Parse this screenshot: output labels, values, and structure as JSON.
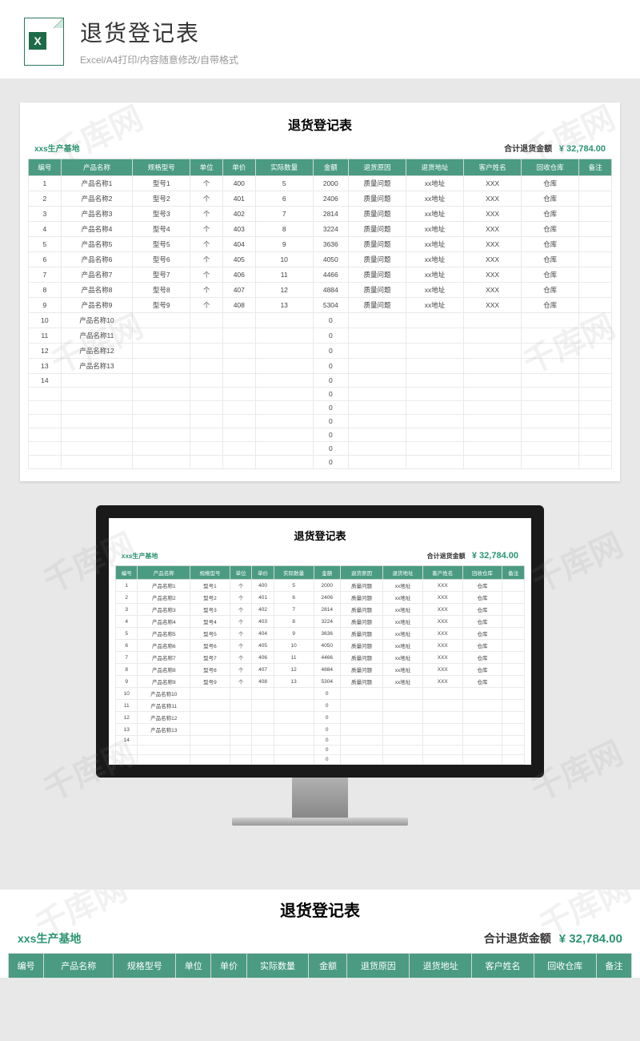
{
  "header": {
    "title": "退货登记表",
    "subtitle": "Excel/A4打印/内容随意修改/自带格式",
    "icon_letter": "X"
  },
  "sheet": {
    "title": "退货登记表",
    "company": "xxs生产基地",
    "total_label": "合计退货金额",
    "total_amount": "¥ 32,784.00"
  },
  "columns": [
    "编号",
    "产品名称",
    "规格型号",
    "单位",
    "单价",
    "实际数量",
    "金额",
    "退货原因",
    "退货地址",
    "客户姓名",
    "回收仓库",
    "备注"
  ],
  "rows": [
    {
      "no": "1",
      "name": "产品名称1",
      "spec": "型号1",
      "unit": "个",
      "price": "400",
      "qty": "5",
      "amount": "2000",
      "reason": "质量问题",
      "addr": "xx地址",
      "cust": "XXX",
      "wh": "仓库",
      "remark": ""
    },
    {
      "no": "2",
      "name": "产品名称2",
      "spec": "型号2",
      "unit": "个",
      "price": "401",
      "qty": "6",
      "amount": "2406",
      "reason": "质量问题",
      "addr": "xx地址",
      "cust": "XXX",
      "wh": "仓库",
      "remark": ""
    },
    {
      "no": "3",
      "name": "产品名称3",
      "spec": "型号3",
      "unit": "个",
      "price": "402",
      "qty": "7",
      "amount": "2814",
      "reason": "质量问题",
      "addr": "xx地址",
      "cust": "XXX",
      "wh": "仓库",
      "remark": ""
    },
    {
      "no": "4",
      "name": "产品名称4",
      "spec": "型号4",
      "unit": "个",
      "price": "403",
      "qty": "8",
      "amount": "3224",
      "reason": "质量问题",
      "addr": "xx地址",
      "cust": "XXX",
      "wh": "仓库",
      "remark": ""
    },
    {
      "no": "5",
      "name": "产品名称5",
      "spec": "型号5",
      "unit": "个",
      "price": "404",
      "qty": "9",
      "amount": "3636",
      "reason": "质量问题",
      "addr": "xx地址",
      "cust": "XXX",
      "wh": "仓库",
      "remark": ""
    },
    {
      "no": "6",
      "name": "产品名称6",
      "spec": "型号6",
      "unit": "个",
      "price": "405",
      "qty": "10",
      "amount": "4050",
      "reason": "质量问题",
      "addr": "xx地址",
      "cust": "XXX",
      "wh": "仓库",
      "remark": ""
    },
    {
      "no": "7",
      "name": "产品名称7",
      "spec": "型号7",
      "unit": "个",
      "price": "406",
      "qty": "11",
      "amount": "4466",
      "reason": "质量问题",
      "addr": "xx地址",
      "cust": "XXX",
      "wh": "仓库",
      "remark": ""
    },
    {
      "no": "8",
      "name": "产品名称8",
      "spec": "型号8",
      "unit": "个",
      "price": "407",
      "qty": "12",
      "amount": "4884",
      "reason": "质量问题",
      "addr": "xx地址",
      "cust": "XXX",
      "wh": "仓库",
      "remark": ""
    },
    {
      "no": "9",
      "name": "产品名称9",
      "spec": "型号9",
      "unit": "个",
      "price": "408",
      "qty": "13",
      "amount": "5304",
      "reason": "质量问题",
      "addr": "xx地址",
      "cust": "XXX",
      "wh": "仓库",
      "remark": ""
    },
    {
      "no": "10",
      "name": "产品名称10",
      "spec": "",
      "unit": "",
      "price": "",
      "qty": "",
      "amount": "0",
      "reason": "",
      "addr": "",
      "cust": "",
      "wh": "",
      "remark": ""
    },
    {
      "no": "11",
      "name": "产品名称11",
      "spec": "",
      "unit": "",
      "price": "",
      "qty": "",
      "amount": "0",
      "reason": "",
      "addr": "",
      "cust": "",
      "wh": "",
      "remark": ""
    },
    {
      "no": "12",
      "name": "产品名称12",
      "spec": "",
      "unit": "",
      "price": "",
      "qty": "",
      "amount": "0",
      "reason": "",
      "addr": "",
      "cust": "",
      "wh": "",
      "remark": ""
    },
    {
      "no": "13",
      "name": "产品名称13",
      "spec": "",
      "unit": "",
      "price": "",
      "qty": "",
      "amount": "0",
      "reason": "",
      "addr": "",
      "cust": "",
      "wh": "",
      "remark": ""
    },
    {
      "no": "14",
      "name": "",
      "spec": "",
      "unit": "",
      "price": "",
      "qty": "",
      "amount": "0",
      "reason": "",
      "addr": "",
      "cust": "",
      "wh": "",
      "remark": ""
    },
    {
      "no": "",
      "name": "",
      "spec": "",
      "unit": "",
      "price": "",
      "qty": "",
      "amount": "0",
      "reason": "",
      "addr": "",
      "cust": "",
      "wh": "",
      "remark": ""
    },
    {
      "no": "",
      "name": "",
      "spec": "",
      "unit": "",
      "price": "",
      "qty": "",
      "amount": "0",
      "reason": "",
      "addr": "",
      "cust": "",
      "wh": "",
      "remark": ""
    },
    {
      "no": "",
      "name": "",
      "spec": "",
      "unit": "",
      "price": "",
      "qty": "",
      "amount": "0",
      "reason": "",
      "addr": "",
      "cust": "",
      "wh": "",
      "remark": ""
    },
    {
      "no": "",
      "name": "",
      "spec": "",
      "unit": "",
      "price": "",
      "qty": "",
      "amount": "0",
      "reason": "",
      "addr": "",
      "cust": "",
      "wh": "",
      "remark": ""
    },
    {
      "no": "",
      "name": "",
      "spec": "",
      "unit": "",
      "price": "",
      "qty": "",
      "amount": "0",
      "reason": "",
      "addr": "",
      "cust": "",
      "wh": "",
      "remark": ""
    },
    {
      "no": "",
      "name": "",
      "spec": "",
      "unit": "",
      "price": "",
      "qty": "",
      "amount": "0",
      "reason": "",
      "addr": "",
      "cust": "",
      "wh": "",
      "remark": ""
    }
  ],
  "watermark": "千库网",
  "chart_data": {
    "type": "table",
    "title": "退货登记表",
    "columns": [
      "编号",
      "产品名称",
      "规格型号",
      "单位",
      "单价",
      "实际数量",
      "金额",
      "退货原因",
      "退货地址",
      "客户姓名",
      "回收仓库",
      "备注"
    ],
    "total": 32784.0
  }
}
